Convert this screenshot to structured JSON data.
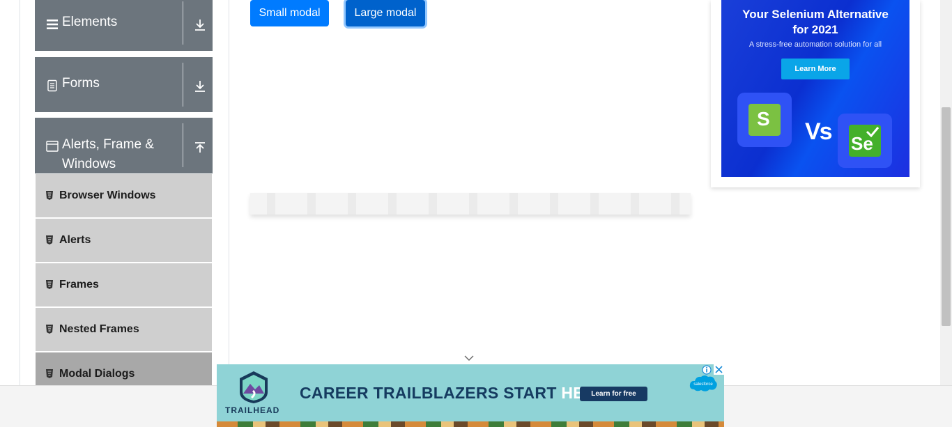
{
  "sidebar": {
    "groups": [
      {
        "label": "Elements",
        "icon": "menu-icon",
        "arrow": "download-arrow-icon"
      },
      {
        "label": "Forms",
        "icon": "document-icon",
        "arrow": "download-arrow-icon"
      },
      {
        "label_line1": "Alerts, Frame &",
        "label_line2": "Windows",
        "icon": "window-icon",
        "arrow": "upload-arrow-icon"
      }
    ],
    "items": [
      {
        "label": "Browser Windows"
      },
      {
        "label": "Alerts"
      },
      {
        "label": "Frames"
      },
      {
        "label": "Nested Frames"
      },
      {
        "label": "Modal Dialogs",
        "active": true
      }
    ]
  },
  "main": {
    "small_modal_label": "Small modal",
    "large_modal_label": "Large modal"
  },
  "right_ad": {
    "headline_line1": "Your Selenium Alternative",
    "headline_line2": "for 2021",
    "subtext": "A stress-free automation solution for all",
    "cta": "Learn More",
    "vs_text": "Vs",
    "tile_left_letter": "S",
    "tile_right_letters": "Se"
  },
  "banner_ad": {
    "brand": "TRAILHEAD",
    "headline_main": "CAREER TRAILBLAZERS START ",
    "headline_accent": "HERE.",
    "cta": "Learn for free",
    "partner": "salesforce"
  },
  "colors": {
    "primary": "#007bff",
    "sidebar_header": "#6c757d",
    "menu_item": "#cfcfcf",
    "menu_item_active": "#a8a8a8"
  }
}
